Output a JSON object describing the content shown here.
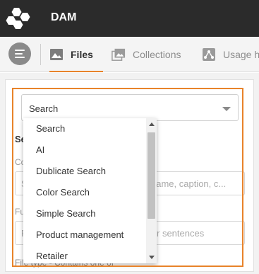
{
  "header": {
    "app_title": "DAM",
    "logo_icon": "hexagon-cluster-logo"
  },
  "tabs": [
    {
      "label": "Files",
      "icon": "image-icon",
      "active": true
    },
    {
      "label": "Collections",
      "icon": "images-stack-icon",
      "active": false
    },
    {
      "label": "Usage h",
      "icon": "share-icon",
      "active": false
    }
  ],
  "search_type_select": {
    "value": "Search",
    "options": [
      "Search",
      "AI",
      "Dublicate Search",
      "Color Search",
      "Simple Search",
      "Product management",
      "Retailer"
    ]
  },
  "background_form": {
    "heading": "Se",
    "label_1": "Co",
    "input_1_placeholder_start": "S",
    "input_1_placeholder_end": "name, caption, c...",
    "label_2": "Fu",
    "input_2_placeholder_start": "P",
    "input_2_placeholder_end": "r sentences",
    "filter_text": "File type - Contains one of"
  },
  "colors": {
    "header_bg": "#2b2b2b",
    "accent": "#e8832a",
    "tab_bar_bg": "#f4f4f4"
  }
}
